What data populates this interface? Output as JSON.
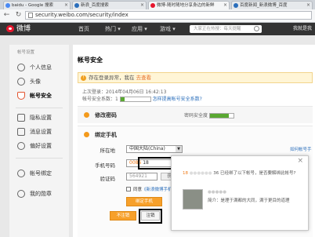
{
  "browser": {
    "tabs": [
      {
        "label": "baidu - Google 搜索",
        "color": "#4a8af4"
      },
      {
        "label": "新浪_百度搜索",
        "color": "#2a6ebb"
      },
      {
        "label": "微博-随时随地分享身边的新鲜",
        "color": "#e6162d"
      },
      {
        "label": "百度新闻_新浪微博_百度",
        "color": "#2a6ebb"
      }
    ],
    "url": "security.weibo.com/security/index"
  },
  "header": {
    "logo": "微博",
    "nav": [
      "首页",
      "热门 ▾",
      "应用 ▾",
      "游戏 ▾"
    ],
    "search_placeholder": "大家正在热搜：每天提醒",
    "user": "我就是我"
  },
  "sidebar": {
    "section_title": "帐号设置",
    "items": [
      {
        "label": "个人信息",
        "icon": "user-icon"
      },
      {
        "label": "头像",
        "icon": "avatar-icon"
      },
      {
        "label": "帐号安全",
        "icon": "shield-icon",
        "active": true
      },
      {
        "label": "隐私设置",
        "icon": "lock-icon"
      },
      {
        "label": "消息设置",
        "icon": "message-icon"
      },
      {
        "label": "偏好设置",
        "icon": "heart-icon"
      },
      {
        "label": "帐号绑定",
        "icon": "link-icon"
      },
      {
        "label": "我的勋章",
        "icon": "medal-icon"
      }
    ]
  },
  "main": {
    "title": "帐号安全",
    "alert": {
      "text": "存在登录异常，我在",
      "link": "去查看"
    },
    "last_login": "上次登录：2014年04月06日 16:42:13",
    "security_level": {
      "label": "帐号安全系数：1",
      "fill": 0.15,
      "link": "怎样提高帐号安全系数?"
    },
    "password": {
      "label": "修改密码",
      "strength_label": "密码安全度",
      "fill": 0.8
    },
    "bind_phone": {
      "label": "绑定手机",
      "region_label": "所在地",
      "region_value": "中国大陆(China)",
      "phone_label": "手机号码",
      "phone_value": "18",
      "code_label": "验证码",
      "code_value": "564921",
      "code_button": "获取验证码",
      "agree_text": "同意",
      "agree_link": "《新浪微博手机服务...》",
      "submit": "绑定手机"
    },
    "right_link": "如何帐号手"
  },
  "dialog": {
    "message_prefix": "18",
    "message_suffix": "36 已经绑了以下帐号，是否要解绑此帐号?",
    "intro": "简介：是理于满都的大同，满于更目的道理",
    "unbind_button": "不注销",
    "cancel_button": "注销"
  }
}
